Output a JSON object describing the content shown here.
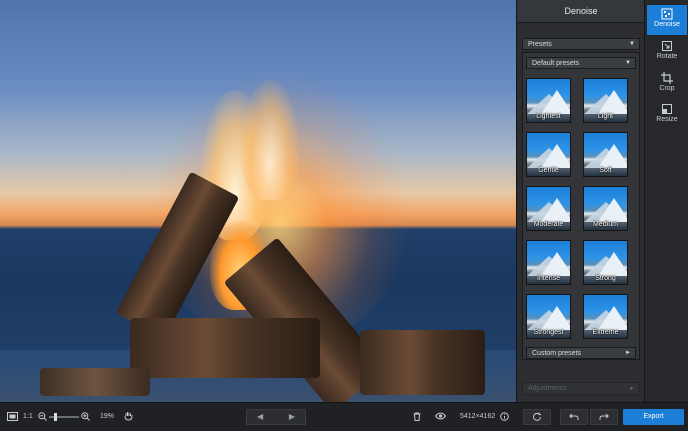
{
  "panel": {
    "title": "Denoise",
    "presets_dropdown": "Presets",
    "default_presets_dropdown": "Default presets",
    "presets": [
      {
        "label": "Lightest"
      },
      {
        "label": "Light"
      },
      {
        "label": "Gentle"
      },
      {
        "label": "Soft"
      },
      {
        "label": "Moderate"
      },
      {
        "label": "Medium"
      },
      {
        "label": "Intense"
      },
      {
        "label": "Strong"
      },
      {
        "label": "Strongest"
      },
      {
        "label": "Extreme"
      }
    ],
    "custom_presets_dropdown": "Custom presets",
    "adjustments_label": "Adjustments"
  },
  "tools": {
    "items": [
      {
        "label": "Denoise",
        "active": true
      },
      {
        "label": "Rotate",
        "active": false
      },
      {
        "label": "Crop",
        "active": false
      },
      {
        "label": "Resize",
        "active": false
      }
    ]
  },
  "bottom": {
    "ratio_label": "1:1",
    "zoom_percent": "19%",
    "image_dimensions": "5412×4162",
    "export_label": "Export",
    "zoom_level": 0.19
  },
  "colors": {
    "accent": "#1c7ed6",
    "panel_bg": "#2b2d30",
    "toolbar_bg": "#202124"
  }
}
